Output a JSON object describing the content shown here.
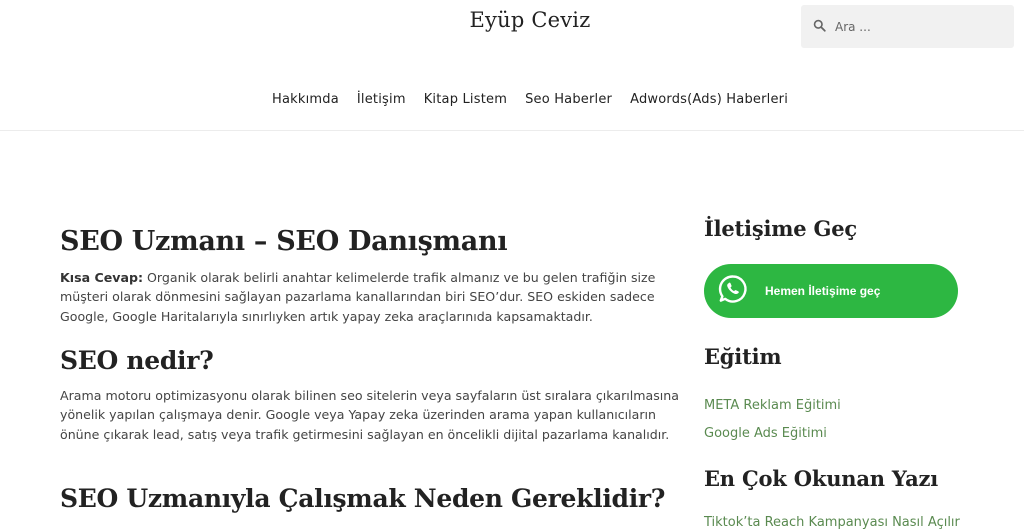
{
  "header": {
    "site_title": "Eyüp Ceviz",
    "search_placeholder": "Ara ..."
  },
  "nav": {
    "items": [
      {
        "label": "Hakkımda"
      },
      {
        "label": "İletişim"
      },
      {
        "label": "Kitap Listem"
      },
      {
        "label": "Seo Haberler"
      },
      {
        "label": "Adwords(Ads) Haberleri"
      }
    ]
  },
  "main": {
    "title": "SEO Uzmanı – SEO Danışmanı",
    "short_answer_label": "Kısa Cevap:",
    "short_answer_text": " Organik olarak belirli anahtar kelimelerde trafik almanız ve bu gelen trafiğin size müşteri olarak dönmesini sağlayan pazarlama kanallarından biri SEO’dur. SEO eskiden sadece Google, Google Haritalarıyla sınırlıyken artık yapay zeka araçlarınıda kapsamaktadır.",
    "section1_heading": "SEO nedir?",
    "section1_text": "Arama motoru optimizasyonu olarak bilinen seo sitelerin veya sayfaların üst sıralara çıkarılmasına yönelik yapılan çalışmaya denir. Google veya Yapay zeka üzerinden arama yapan kullanıcıların önüne çıkarak lead, satış veya trafik getirmesini sağlayan en öncelikli dijital pazarlama kanalıdır.",
    "section2_heading": "SEO Uzmanıyla Çalışmak Neden Gereklidir?"
  },
  "sidebar": {
    "contact_heading": "İletişime Geç",
    "whatsapp_label": "Hemen İletişime geç",
    "education_heading": "Eğitim",
    "education_links": [
      {
        "label": "META Reklam Eğitimi"
      },
      {
        "label": "Google Ads Eğitimi"
      }
    ],
    "popular_heading": "En Çok Okunan Yazı",
    "popular_link": "Tiktok’ta Reach Kampanyası Nasıl Açılır"
  },
  "colors": {
    "whatsapp_green": "#2db742",
    "link_green": "#5a8a50",
    "search_bg": "#f1f1f1"
  },
  "icons": [
    "search-icon",
    "whatsapp-icon"
  ]
}
